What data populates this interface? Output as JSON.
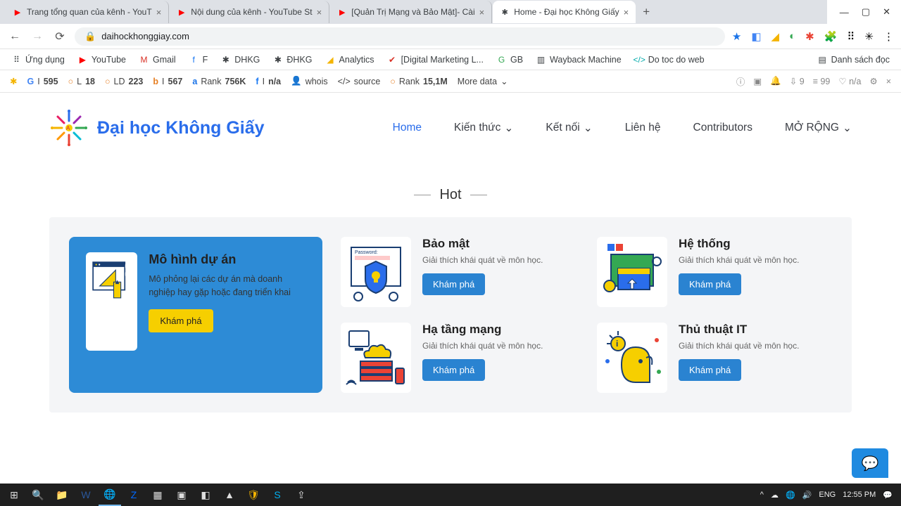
{
  "browser": {
    "tabs": [
      {
        "title": "Trang tổng quan của kênh - YouT",
        "icon": "▶"
      },
      {
        "title": "Nội dung của kênh - YouTube St",
        "icon": "▶"
      },
      {
        "title": "[Quản Trị Mạng và Bảo Mật]- Cài",
        "icon": "▶"
      },
      {
        "title": "Home - Đại học Không Giấy",
        "icon": "✱",
        "active": true
      }
    ],
    "url": "daihockhonggiay.com",
    "bookmarks": [
      {
        "label": "Ứng dụng",
        "icon": "⠿"
      },
      {
        "label": "YouTube",
        "icon": "▶"
      },
      {
        "label": "Gmail",
        "icon": "M"
      },
      {
        "label": "F",
        "icon": "f"
      },
      {
        "label": "DHKG",
        "icon": "✱"
      },
      {
        "label": "ĐHKG",
        "icon": "✱"
      },
      {
        "label": "Analytics",
        "icon": "◢"
      },
      {
        "label": "[Digital Marketing L...",
        "icon": "✔"
      },
      {
        "label": "GB",
        "icon": "G"
      },
      {
        "label": "Wayback Machine",
        "icon": "▥"
      },
      {
        "label": "Do toc do web",
        "icon": "</>"
      }
    ],
    "reading_list": "Danh sách đọc",
    "seo_toolbar": {
      "items": [
        {
          "icon": "G",
          "label": "I",
          "value": "595"
        },
        {
          "icon": "○",
          "label": "L",
          "value": "18"
        },
        {
          "icon": "○",
          "label": "LD",
          "value": "223"
        },
        {
          "icon": "b",
          "label": "I",
          "value": "567"
        },
        {
          "icon": "a",
          "label": "Rank",
          "value": "756K"
        },
        {
          "icon": "f",
          "label": "I",
          "value": "n/a"
        },
        {
          "icon": "👤",
          "label": "whois",
          "value": ""
        },
        {
          "icon": "</>",
          "label": "source",
          "value": ""
        },
        {
          "icon": "○",
          "label": "Rank",
          "value": "15,1M"
        }
      ],
      "more": "More data",
      "right": [
        {
          "icon": "⇩",
          "value": "9"
        },
        {
          "icon": "≡",
          "value": "99"
        },
        {
          "icon": "♡",
          "value": "n/a"
        }
      ]
    }
  },
  "site": {
    "brand": "Đại học Không Giấy",
    "nav": [
      {
        "label": "Home",
        "active": true
      },
      {
        "label": "Kiến thức",
        "dropdown": true
      },
      {
        "label": "Kết nối",
        "dropdown": true
      },
      {
        "label": "Liên hệ"
      },
      {
        "label": "Contributors"
      },
      {
        "label": "MỞ RỘNG",
        "dropdown": true
      }
    ],
    "hot_label": "Hot",
    "featured": {
      "title": "Mô hình dự án",
      "desc": "Mô phỏng lại các dự án mà doanh nghiệp hay gặp hoặc đang triển khai",
      "btn": "Khám phá"
    },
    "cats": [
      {
        "title": "Bảo mật",
        "desc": "Giải thích khái quát về môn học.",
        "btn": "Khám phá"
      },
      {
        "title": "Hệ thống",
        "desc": "Giải thích khái quát về môn học.",
        "btn": "Khám phá"
      },
      {
        "title": "Hạ tầng mạng",
        "desc": "Giải thích khái quát về môn học.",
        "btn": "Khám phá"
      },
      {
        "title": "Thủ thuật IT",
        "desc": "Giải thích khái quát về môn học.",
        "btn": "Khám phá"
      }
    ]
  },
  "taskbar": {
    "lang": "ENG",
    "time": "12:55 PM"
  }
}
